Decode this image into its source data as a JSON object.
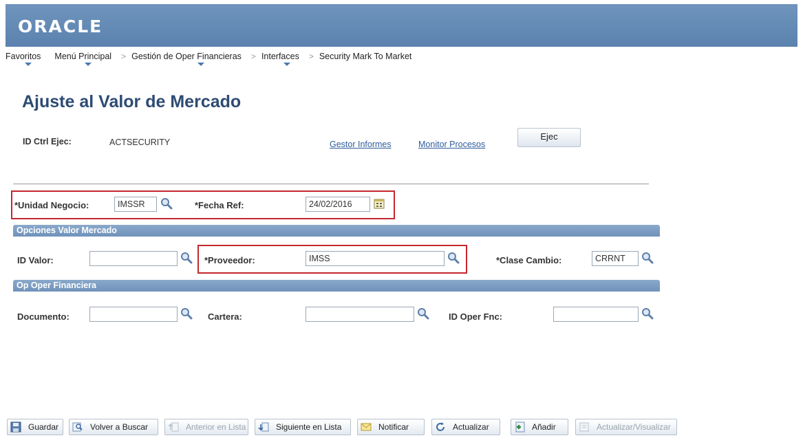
{
  "header": {
    "logo": "ORACLE"
  },
  "nav": {
    "items": [
      {
        "label": "Favoritos"
      },
      {
        "label": "Menú Principal"
      },
      {
        "label": "Gestión de Oper Financieras"
      },
      {
        "label": "Interfaces"
      },
      {
        "label": "Security Mark To Market"
      }
    ],
    "separator": ">"
  },
  "page": {
    "title": "Ajuste al Valor de Mercado",
    "run_control_label": "ID Ctrl Ejec:",
    "run_control_value": "ACTSECURITY",
    "link_report_manager": "Gestor Informes",
    "link_process_monitor": "Monitor Procesos",
    "run_button": "Ejec"
  },
  "fields": {
    "business_unit_label": "*Unidad Negocio:",
    "business_unit_value": "IMSSR",
    "ref_date_label": "*Fecha Ref:",
    "ref_date_value": "24/02/2016"
  },
  "section_market": {
    "title": "Opciones Valor Mercado",
    "id_valor_label": "ID Valor:",
    "id_valor_value": "",
    "provider_label": "*Proveedor:",
    "provider_value": "IMSS",
    "rate_class_label": "*Clase Cambio:",
    "rate_class_value": "CRRNT"
  },
  "section_fin": {
    "title": "Op Oper Financiera",
    "document_label": "Documento:",
    "document_value": "",
    "portfolio_label": "Cartera:",
    "portfolio_value": "",
    "deal_id_label": "ID Oper Fnc:",
    "deal_id_value": ""
  },
  "toolbar": {
    "save": "Guardar",
    "return_search": "Volver a Buscar",
    "prev_list": "Anterior en Lista",
    "next_list": "Siguiente en Lista",
    "notify": "Notificar",
    "refresh": "Actualizar",
    "add": "Añadir",
    "update_display": "Actualizar/Visualizar"
  },
  "colors": {
    "header_blue": "#5b82ae",
    "title_blue": "#2d4b74",
    "highlight_red": "#c4262e",
    "section_blue": "#7092ba"
  }
}
